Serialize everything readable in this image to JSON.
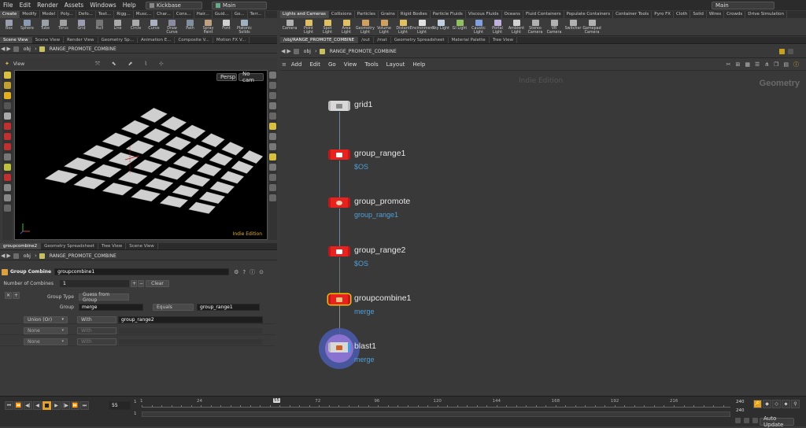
{
  "menubar": {
    "items": [
      "File",
      "Edit",
      "Render",
      "Assets",
      "Windows",
      "Help"
    ],
    "desktop": "Kickbase",
    "workspace": "Main",
    "right_workspace": "Main"
  },
  "shelf_left": {
    "tabs": [
      "Create",
      "Modify",
      "Model",
      "Poly...",
      "Defo...",
      "Text...",
      "Rigg...",
      "Musc...",
      "Char...",
      "Cons...",
      "Hair...",
      "Guid...",
      "Go...",
      "Terr..."
    ],
    "tools": [
      "Box",
      "Sphere",
      "Tube",
      "Torus",
      "Grid",
      "Null",
      "Line",
      "Circle",
      "Curve",
      "Draw Curve",
      "Path",
      "Spray Paint",
      "Font",
      "Platonic Solids"
    ]
  },
  "shelf_right": {
    "tabs": [
      "Lights and Cameras",
      "Collisions",
      "Particles",
      "Grains",
      "Rigid Bodies",
      "Particle Fluids",
      "Viscous Fluids",
      "Oceans",
      "Fluid Containers",
      "Populate Containers",
      "Container Tools",
      "Pyro FX",
      "Cloth",
      "Solid",
      "Wires",
      "Crowds",
      "Drive Simulation"
    ],
    "tools": [
      "Camera",
      "Point Light",
      "Spot Light",
      "Area Light",
      "Geometry Light",
      "Volume Light",
      "Distant Light",
      "Environment Light",
      "Sky Light",
      "GI Light",
      "Caustic Light",
      "Portal Light",
      "Ambient Light",
      "Stereo Camera",
      "VR Camera",
      "Switcher",
      "Gamepad Camera"
    ]
  },
  "left_pane_tabs": [
    "Scene View",
    "Scene View",
    "Render View",
    "Geometry Sp...",
    "Animation E...",
    "Composite V...",
    "Motion FX V..."
  ],
  "right_pane_tabs": [
    "/obj/RANGE_PROMOTE_COMBINE",
    "/out",
    "/mat",
    "Geometry Spreadsheet",
    "Material Palette",
    "Tree View"
  ],
  "path": {
    "context": "obj",
    "node": "RANGE_PROMOTE_COMBINE"
  },
  "viewport": {
    "title": "View",
    "persp": "Persp",
    "cam": "No cam",
    "edition": "Indie Edition"
  },
  "param_tabs": [
    "groupcombine2",
    "Geometry Spreadsheet",
    "Tree View",
    "Scene View"
  ],
  "params": {
    "node_type": "Group Combine",
    "node_name": "groupcombine1",
    "num_combines_label": "Number of Combines",
    "num_combines": "1",
    "clear": "Clear",
    "group_type_label": "Group Type",
    "group_type": "Guess from Group",
    "group_label": "Group",
    "group_value": "merge",
    "equals": "Equals",
    "equals_value": "group_range1",
    "rows": [
      {
        "op": "Union (Or)",
        "with": "With",
        "value": "group_range2"
      },
      {
        "op": "None",
        "with": "With",
        "value": ""
      },
      {
        "op": "None",
        "with": "With",
        "value": ""
      }
    ]
  },
  "network_menu": [
    "Add",
    "Edit",
    "Go",
    "View",
    "Tools",
    "Layout",
    "Help"
  ],
  "network": {
    "watermark": "Indie Edition",
    "context_label": "Geometry",
    "nodes": [
      {
        "name": "grid1",
        "sub": ""
      },
      {
        "name": "group_range1",
        "sub": "$OS"
      },
      {
        "name": "group_promote",
        "sub": "group_range1"
      },
      {
        "name": "group_range2",
        "sub": "$OS"
      },
      {
        "name": "groupcombine1",
        "sub": "merge"
      },
      {
        "name": "blast1",
        "sub": "merge"
      }
    ]
  },
  "timeline": {
    "frame": "55",
    "start": "1",
    "start2": "1",
    "ticks": [
      "1",
      "24",
      "55",
      "72",
      "96",
      "120",
      "144",
      "168",
      "192",
      "216"
    ],
    "end1": "240",
    "end2": "240",
    "auto_update": "Auto Update"
  },
  "colors": {
    "node_red": "#e8231f",
    "node_selected_border": "#f0c000",
    "link_blue": "#4f9fd8",
    "display_flag": "#3aa0e0",
    "blast_halo": "#7b6fd0"
  }
}
